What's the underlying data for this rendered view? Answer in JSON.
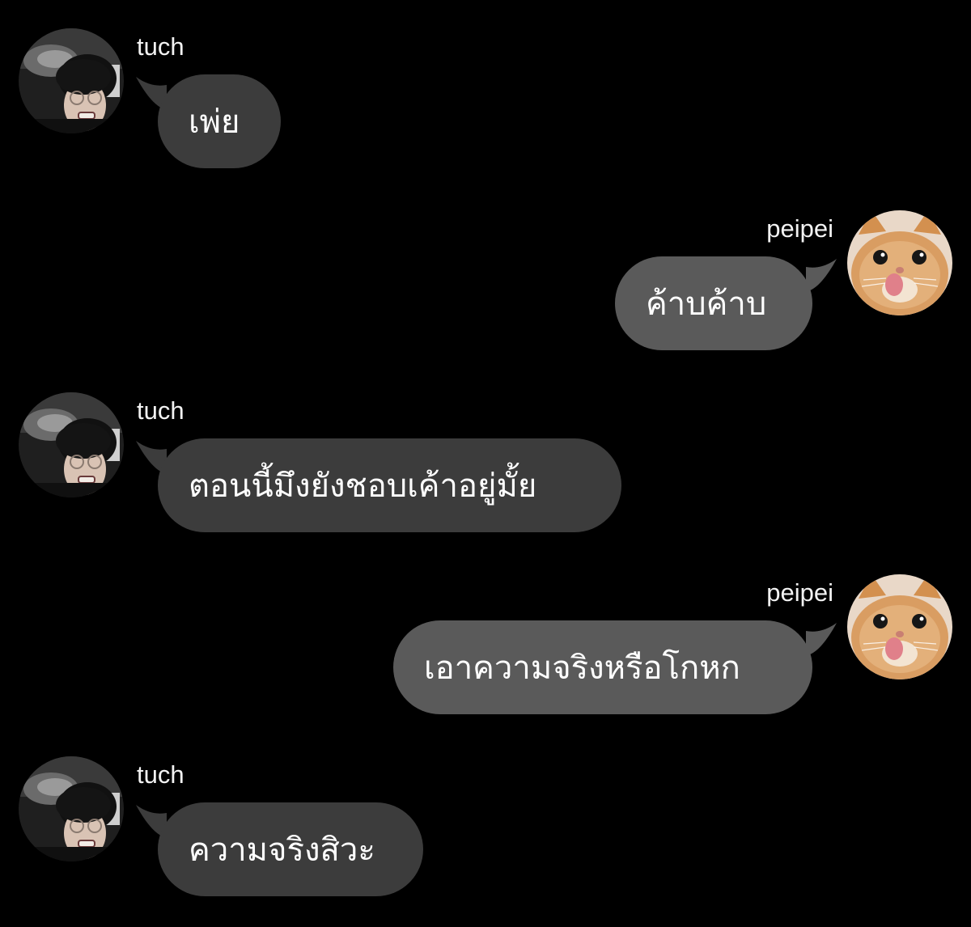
{
  "conversation": {
    "messages": [
      {
        "sender": "tuch",
        "text": "เพ่ย",
        "direction": "incoming",
        "avatar": "person-photo-avatar"
      },
      {
        "sender": "peipei",
        "text": "ค้าบค้าบ",
        "direction": "outgoing",
        "avatar": "cat-photo-avatar"
      },
      {
        "sender": "tuch",
        "text": "ตอนนี้มึงยังชอบเค้าอยู่มั้ย",
        "direction": "incoming",
        "avatar": "person-photo-avatar"
      },
      {
        "sender": "peipei",
        "text": "เอาความจริงหรือโกหก",
        "direction": "outgoing",
        "avatar": "cat-photo-avatar"
      },
      {
        "sender": "tuch",
        "text": "ความจริงสิวะ",
        "direction": "incoming",
        "avatar": "person-photo-avatar"
      }
    ]
  },
  "colors": {
    "background": "#000000",
    "incoming_bubble": "#3c3c3c",
    "outgoing_bubble": "#5a5a5a",
    "text": "#ffffff"
  }
}
